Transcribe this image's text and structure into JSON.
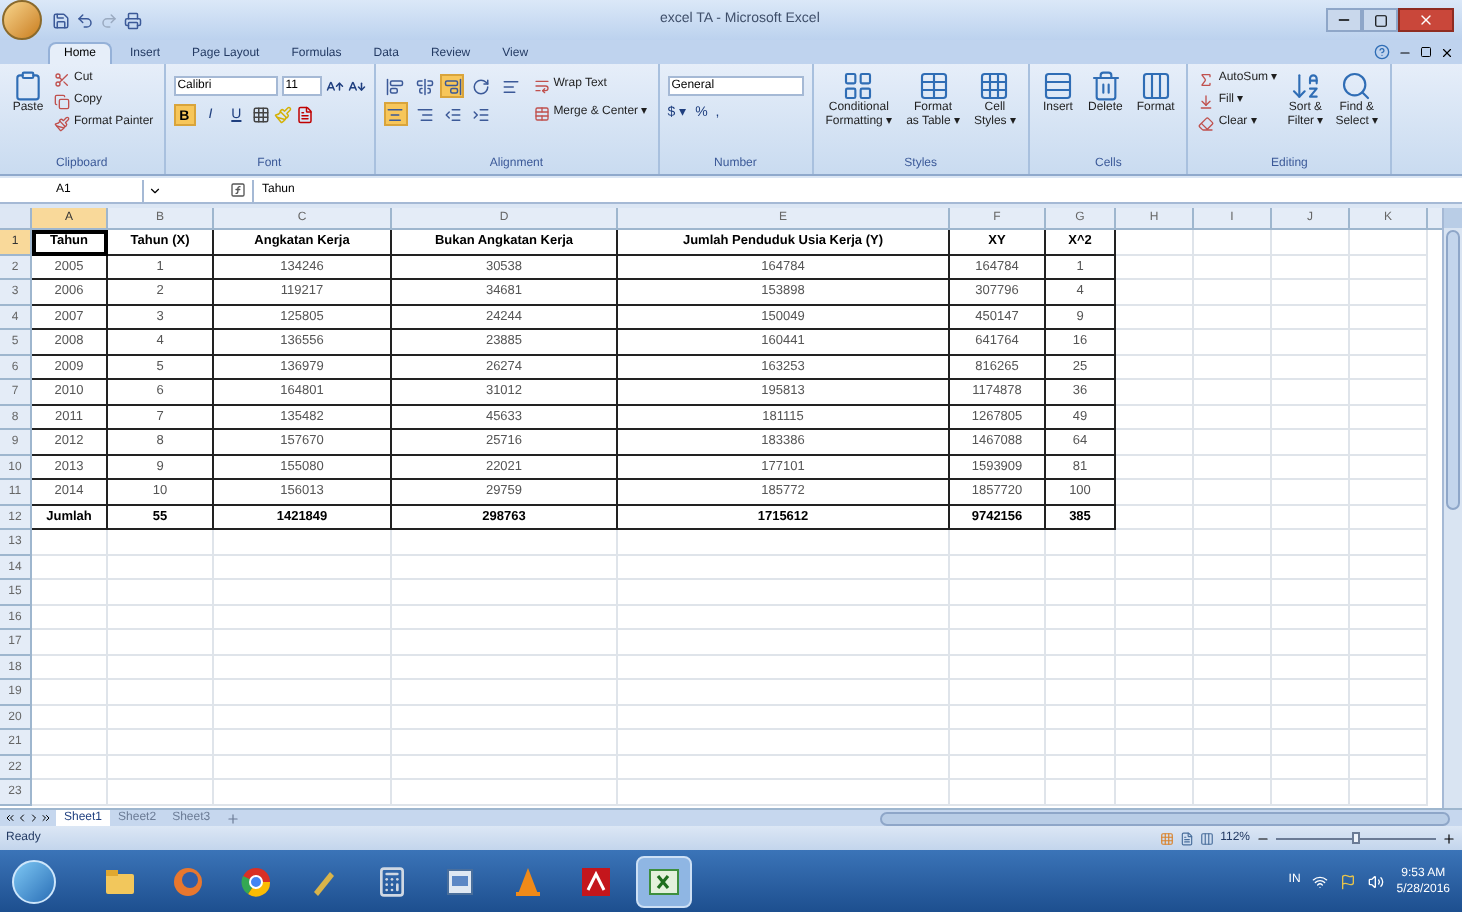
{
  "window": {
    "title": "excel TA - Microsoft Excel"
  },
  "tabs": [
    {
      "label": "Home",
      "selected": true
    },
    {
      "label": "Insert",
      "selected": false
    },
    {
      "label": "Page Layout",
      "selected": false
    },
    {
      "label": "Formulas",
      "selected": false
    },
    {
      "label": "Data",
      "selected": false
    },
    {
      "label": "Review",
      "selected": false
    },
    {
      "label": "View",
      "selected": false
    }
  ],
  "ribbon": {
    "groups": [
      {
        "kind": "clipboard",
        "label": "Clipboard",
        "large": [
          {
            "label": "Paste"
          }
        ],
        "small": [
          {
            "label": "Cut"
          },
          {
            "label": "Copy"
          },
          {
            "label": "Format Painter"
          }
        ]
      },
      {
        "kind": "font",
        "label": "Font",
        "font_name": "Calibri",
        "font_size": "11",
        "format_buttons": [
          {
            "label": "B",
            "on": true
          },
          {
            "label": "I",
            "on": false
          },
          {
            "label": "U",
            "on": false
          }
        ]
      },
      {
        "kind": "alignment",
        "label": "Alignment",
        "buttons": [
          {
            "on": false
          },
          {
            "on": false
          },
          {
            "on": true
          },
          {
            "on": false
          },
          {
            "on": false
          },
          {
            "on": true
          },
          {
            "on": false
          },
          {
            "on": false
          },
          {
            "on": false
          }
        ],
        "small": [
          {
            "label": "Wrap Text"
          },
          {
            "label": "Merge & Center ▾"
          }
        ]
      },
      {
        "kind": "number",
        "label": "Number",
        "format": "General",
        "symbols": [
          "$ ▾",
          "%",
          ","
        ]
      },
      {
        "kind": "large",
        "label": "Styles",
        "large": [
          {
            "label": "Conditional\nFormatting ▾"
          },
          {
            "label": "Format\nas Table ▾"
          },
          {
            "label": "Cell\nStyles ▾"
          }
        ]
      },
      {
        "kind": "large",
        "label": "Cells",
        "large": [
          {
            "label": "Insert"
          },
          {
            "label": "Delete"
          },
          {
            "label": "Format"
          }
        ]
      },
      {
        "kind": "editing",
        "label": "Editing",
        "small": [
          {
            "label": "AutoSum ▾"
          },
          {
            "label": "Fill ▾"
          },
          {
            "label": "Clear ▾"
          }
        ],
        "large": [
          {
            "label": "Sort &\nFilter ▾"
          },
          {
            "label": "Find &\nSelect ▾"
          }
        ]
      }
    ]
  },
  "formula_bar": {
    "name_box": "A1",
    "value": "Tahun"
  },
  "sheet": {
    "columns": [
      {
        "label": "A",
        "selected": true
      },
      {
        "label": "B",
        "selected": false
      },
      {
        "label": "C",
        "selected": false
      },
      {
        "label": "D",
        "selected": false
      },
      {
        "label": "E",
        "selected": false
      },
      {
        "label": "F",
        "selected": false
      },
      {
        "label": "G",
        "selected": false
      },
      {
        "label": "H",
        "selected": false
      },
      {
        "label": "I",
        "selected": false
      },
      {
        "label": "J",
        "selected": false
      },
      {
        "label": "K",
        "selected": false
      }
    ],
    "rows": [
      {
        "number": "1",
        "selected": true,
        "bold": true,
        "cells": [
          "Tahun",
          "Tahun (X)",
          "Angkatan Kerja",
          "Bukan Angkatan Kerja",
          "Jumlah Penduduk Usia Kerja (Y)",
          "XY",
          "X^2"
        ]
      },
      {
        "number": "2",
        "selected": false,
        "bold": false,
        "cells": [
          "2005",
          "1",
          "134246",
          "30538",
          "164784",
          "164784",
          "1"
        ]
      },
      {
        "number": "3",
        "selected": false,
        "bold": false,
        "cells": [
          "2006",
          "2",
          "119217",
          "34681",
          "153898",
          "307796",
          "4"
        ]
      },
      {
        "number": "4",
        "selected": false,
        "bold": false,
        "cells": [
          "2007",
          "3",
          "125805",
          "24244",
          "150049",
          "450147",
          "9"
        ]
      },
      {
        "number": "5",
        "selected": false,
        "bold": false,
        "cells": [
          "2008",
          "4",
          "136556",
          "23885",
          "160441",
          "641764",
          "16"
        ]
      },
      {
        "number": "6",
        "selected": false,
        "bold": false,
        "cells": [
          "2009",
          "5",
          "136979",
          "26274",
          "163253",
          "816265",
          "25"
        ]
      },
      {
        "number": "7",
        "selected": false,
        "bold": false,
        "cells": [
          "2010",
          "6",
          "164801",
          "31012",
          "195813",
          "1174878",
          "36"
        ]
      },
      {
        "number": "8",
        "selected": false,
        "bold": false,
        "cells": [
          "2011",
          "7",
          "135482",
          "45633",
          "181115",
          "1267805",
          "49"
        ]
      },
      {
        "number": "9",
        "selected": false,
        "bold": false,
        "cells": [
          "2012",
          "8",
          "157670",
          "25716",
          "183386",
          "1467088",
          "64"
        ]
      },
      {
        "number": "10",
        "selected": false,
        "bold": false,
        "cells": [
          "2013",
          "9",
          "155080",
          "22021",
          "177101",
          "1593909",
          "81"
        ]
      },
      {
        "number": "11",
        "selected": false,
        "bold": false,
        "cells": [
          "2014",
          "10",
          "156013",
          "29759",
          "185772",
          "1857720",
          "100"
        ]
      },
      {
        "number": "12",
        "selected": false,
        "bold": true,
        "cells": [
          "Jumlah",
          "55",
          "1421849",
          "298763",
          "1715612",
          "9742156",
          "385"
        ]
      },
      {
        "number": "13",
        "selected": false
      },
      {
        "number": "14",
        "selected": false
      },
      {
        "number": "15",
        "selected": false
      },
      {
        "number": "16",
        "selected": false
      },
      {
        "number": "17",
        "selected": false
      },
      {
        "number": "18",
        "selected": false
      },
      {
        "number": "19",
        "selected": false
      },
      {
        "number": "20",
        "selected": false
      },
      {
        "number": "21",
        "selected": false
      },
      {
        "number": "22",
        "selected": false
      },
      {
        "number": "23",
        "selected": false
      }
    ]
  },
  "sheet_tabs": [
    {
      "label": "Sheet1",
      "selected": true
    },
    {
      "label": "Sheet2",
      "selected": false
    },
    {
      "label": "Sheet3",
      "selected": false
    }
  ],
  "status_bar": {
    "status": "Ready",
    "zoom": "112%",
    "zoom_level": {
      "level": 0.5
    }
  },
  "taskbar": {
    "apps": [
      {
        "selected": false
      },
      {
        "selected": false
      },
      {
        "selected": false
      },
      {
        "selected": false
      },
      {
        "selected": false
      },
      {
        "selected": false
      },
      {
        "selected": false
      },
      {
        "selected": false
      },
      {
        "selected": true
      }
    ],
    "language": "IN",
    "time": "9:53 AM",
    "date": "5/28/2016"
  }
}
